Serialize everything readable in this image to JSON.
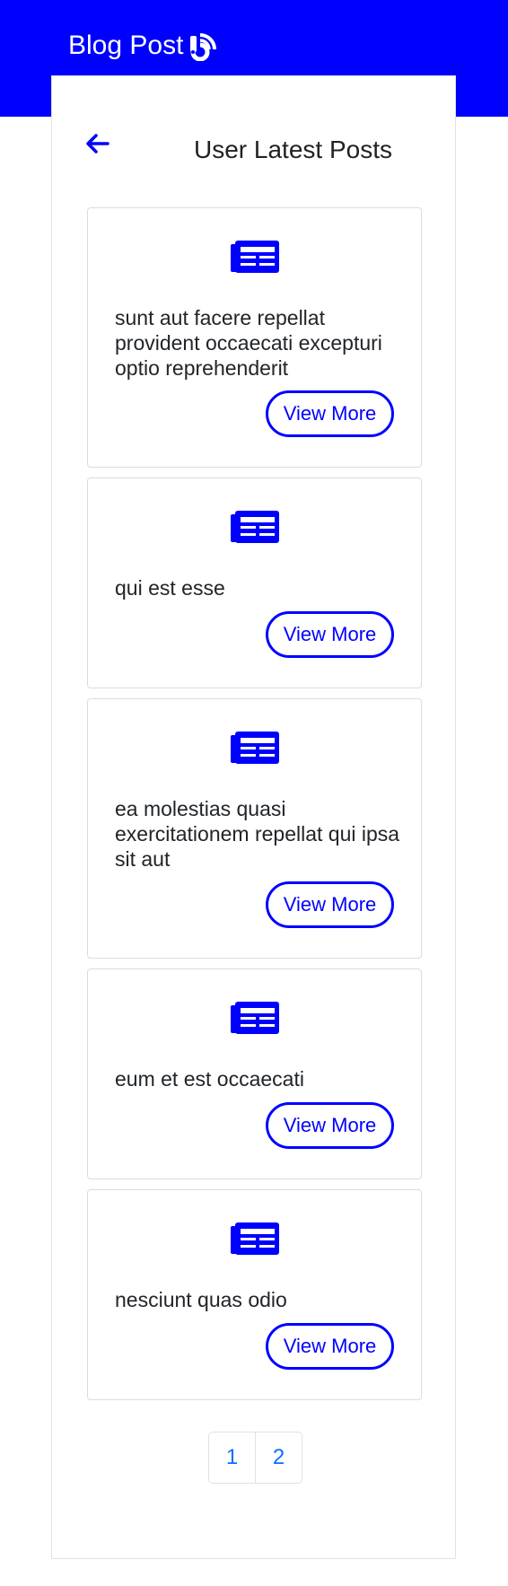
{
  "header": {
    "brand": "Blog Post",
    "brand_icon": "rss-icon",
    "background": "#0000ff"
  },
  "page": {
    "title": "User Latest Posts",
    "back_icon": "arrow-left-icon"
  },
  "posts": [
    {
      "icon": "newspaper-icon",
      "title": "sunt aut facere repellat provident occaecati excepturi optio reprehenderit",
      "button": "View More"
    },
    {
      "icon": "newspaper-icon",
      "title": "qui est esse",
      "button": "View More"
    },
    {
      "icon": "newspaper-icon",
      "title": "ea molestias quasi exercitationem repellat qui ipsa sit aut",
      "button": "View More"
    },
    {
      "icon": "newspaper-icon",
      "title": "eum et est occaecati",
      "button": "View More"
    },
    {
      "icon": "newspaper-icon",
      "title": "nesciunt quas odio",
      "button": "View More"
    }
  ],
  "pagination": {
    "pages": [
      "1",
      "2"
    ]
  },
  "colors": {
    "accent": "#0000ff",
    "page_link": "#0d6efd"
  }
}
